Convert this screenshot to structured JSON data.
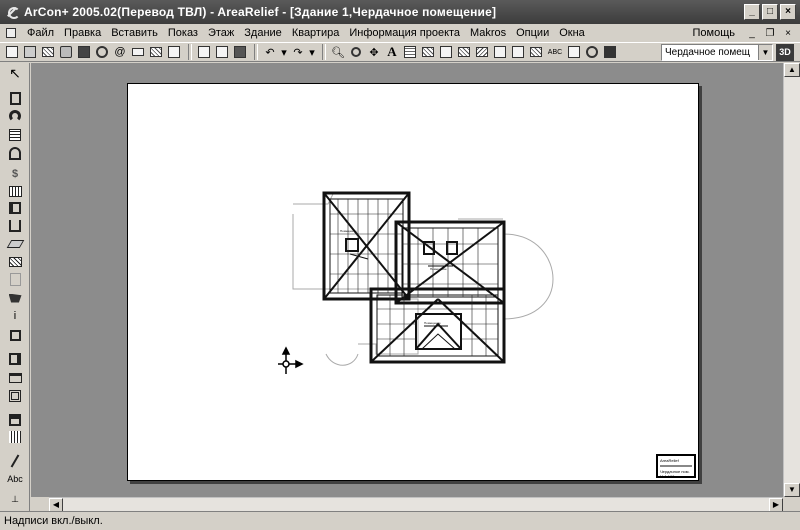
{
  "window": {
    "title": "ArCon+  2005.02(Перевод ТВЛ)  - AreaRelief - [Здание 1,Чердачное помещение]",
    "minimize_label": "_",
    "maximize_label": "□",
    "close_label": "×"
  },
  "menu": {
    "items": [
      "Файл",
      "Правка",
      "Вставить",
      "Показ",
      "Этаж",
      "Здание",
      "Квартира",
      "Информация проекта",
      "Makros",
      "Опции",
      "Окна"
    ],
    "help": "Помощь",
    "mdi_minimize": "_",
    "mdi_restore": "❐",
    "mdi_close": "×"
  },
  "toolbar": {
    "floor_value": "Чердачное помещ",
    "button_3d": "3D",
    "text_button": "A",
    "abc_button": "ABC"
  },
  "lefttools": {
    "abc_label": "Abc"
  },
  "status": {
    "text": "Надписи вкл./выкл."
  },
  "titleblock": {
    "line1": "AreaRelief",
    "line2": "Чердачное пом.",
    "line3": "М 1:100"
  }
}
